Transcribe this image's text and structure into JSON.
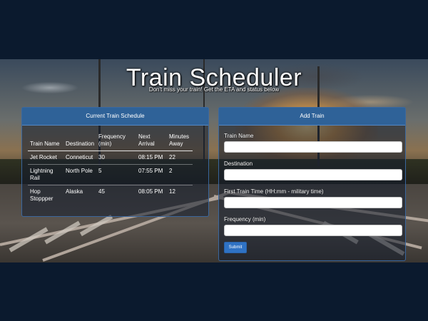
{
  "header": {
    "title": "Train Scheduler",
    "tagline": "Don't miss your train! Get the ETA and status below"
  },
  "schedule": {
    "title": "Current Train Schedule",
    "columns": [
      "Train Name",
      "Destination",
      "Frequency (min)",
      "Next Arrival",
      "Minutes Away"
    ],
    "rows": [
      {
        "name": "Jet Rocket",
        "destination": "Conneticut",
        "frequency": "30",
        "next_arrival": "08:15 PM",
        "minutes_away": "22"
      },
      {
        "name": "Lightning Rail",
        "destination": "North Pole",
        "frequency": "5",
        "next_arrival": "07:55 PM",
        "minutes_away": "2"
      },
      {
        "name": "Hop Stoppper",
        "destination": "Alaska",
        "frequency": "45",
        "next_arrival": "08:05 PM",
        "minutes_away": "12"
      }
    ]
  },
  "add_train": {
    "title": "Add Train",
    "name_label": "Train Name",
    "name_value": "",
    "destination_label": "Destination",
    "destination_value": "",
    "first_time_label": "First Train Time (HH:mm - military time)",
    "first_time_value": "",
    "frequency_label": "Frequency (min)",
    "frequency_value": "",
    "submit_label": "Submit"
  },
  "colors": {
    "page_background": "#0b1a2e",
    "panel_header": "#2f6298",
    "submit_button": "#2f72c4"
  }
}
